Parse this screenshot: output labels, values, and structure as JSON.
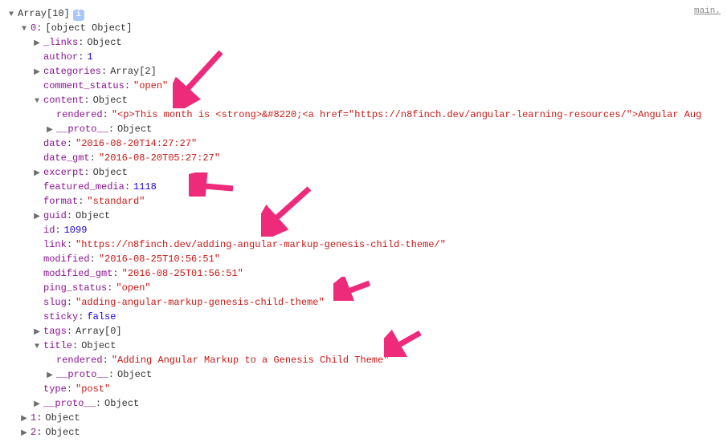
{
  "top_right_label": "main.",
  "root": {
    "label": "Array[10]"
  },
  "info_badge": "i",
  "item0": {
    "index": "0",
    "type": {
      "key": "type",
      "val": "\"post\""
    },
    "links": {
      "key": "_links",
      "val": "Object"
    },
    "author": {
      "key": "author",
      "val": "1"
    },
    "categories": {
      "key": "categories",
      "val": "Array[2]"
    },
    "comment_status": {
      "key": "comment_status",
      "val": "\"open\""
    },
    "content": {
      "key": "content",
      "val": "Object",
      "rendered_key": "rendered",
      "rendered_val": "\"<p>This month is <strong>&#8220;<a href=\"https://n8finch.dev/angular-learning-resources/\">Angular Aug",
      "proto_key": "__proto__",
      "proto_val": "Object"
    },
    "date": {
      "key": "date",
      "val": "\"2016-08-20T14:27:27\""
    },
    "date_gmt": {
      "key": "date_gmt",
      "val": "\"2016-08-20T05:27:27\""
    },
    "excerpt": {
      "key": "excerpt",
      "val": "Object"
    },
    "featured_media": {
      "key": "featured_media",
      "val": "1118"
    },
    "format": {
      "key": "format",
      "val": "\"standard\""
    },
    "guid": {
      "key": "guid",
      "val": "Object"
    },
    "id": {
      "key": "id",
      "val": "1099"
    },
    "link": {
      "key": "link",
      "val": "\"https://n8finch.dev/adding-angular-markup-genesis-child-theme/\""
    },
    "modified": {
      "key": "modified",
      "val": "\"2016-08-25T10:56:51\""
    },
    "modified_gmt": {
      "key": "modified_gmt",
      "val": "\"2016-08-25T01:56:51\""
    },
    "ping_status": {
      "key": "ping_status",
      "val": "\"open\""
    },
    "slug": {
      "key": "slug",
      "val": "\"adding-angular-markup-genesis-child-theme\""
    },
    "sticky": {
      "key": "sticky",
      "val": "false"
    },
    "tags": {
      "key": "tags",
      "val": "Array[0]"
    },
    "title": {
      "key": "title",
      "val": "Object",
      "rendered_key": "rendered",
      "rendered_val": "\"Adding Angular Markup to a Genesis Child Theme\"",
      "proto_key": "__proto__",
      "proto_val": "Object"
    },
    "proto": {
      "key": "__proto__",
      "val": "Object"
    }
  },
  "item1": {
    "index": "1",
    "type": "Object"
  },
  "item2": {
    "index": "2",
    "type": "Object"
  }
}
